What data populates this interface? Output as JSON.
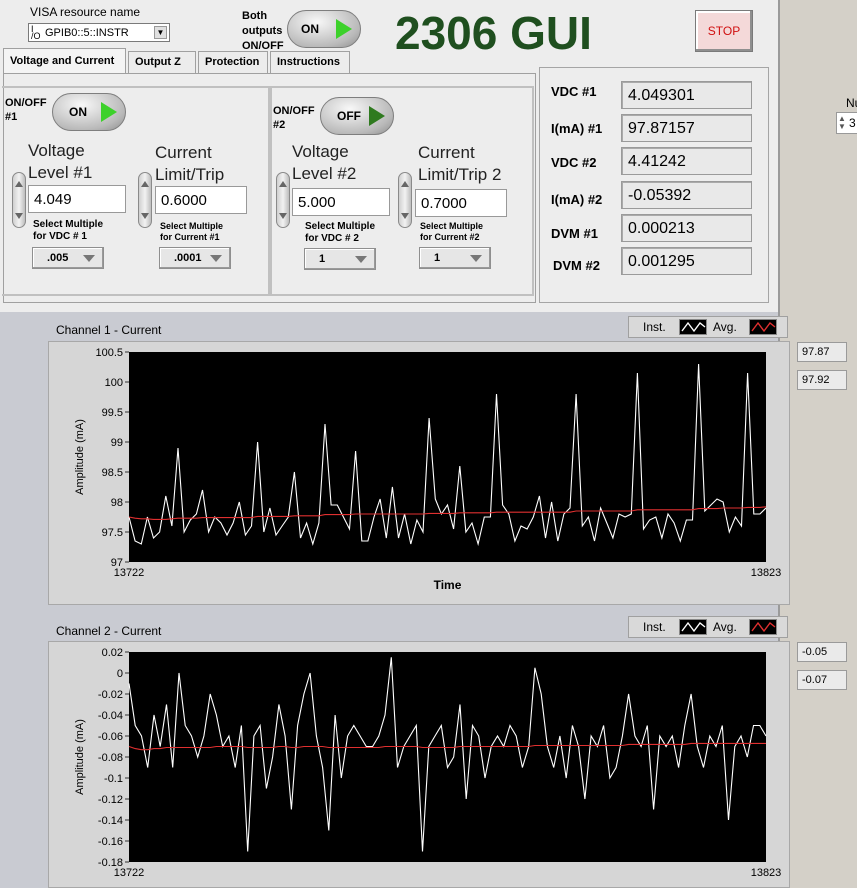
{
  "window": {
    "title": "2306 GUI"
  },
  "visa": {
    "label": "VISA resource name",
    "io_icon": "I/O",
    "value": "GPIB0::5::INSTR"
  },
  "both_outputs": {
    "label_line1": "Both",
    "label_line2": "outputs",
    "label_line3": "ON/OFF",
    "state": "ON"
  },
  "stop_button": {
    "label": "STOP"
  },
  "tabs": [
    {
      "label": "Voltage and Current"
    },
    {
      "label": "Output Z"
    },
    {
      "label": "Protection"
    },
    {
      "label": "Instructions"
    }
  ],
  "ch1": {
    "onoff_label_a": "ON/OFF",
    "onoff_label_b": "#1",
    "state": "ON",
    "voltage_label_a": "Voltage",
    "voltage_label_b": "Level #1",
    "voltage_value": "4.049",
    "current_label_a": "Current",
    "current_label_b": "Limit/Trip",
    "current_value": "0.6000",
    "mult_v_label_a": "Select Multiple",
    "mult_v_label_b": "for VDC # 1",
    "mult_v_value": ".005",
    "mult_i_label_a": "Select Multiple",
    "mult_i_label_b": "for Current #1",
    "mult_i_value": ".0001"
  },
  "ch2": {
    "onoff_label_a": "ON/OFF",
    "onoff_label_b": "#2",
    "state": "OFF",
    "voltage_label_a": "Voltage",
    "voltage_label_b": "Level #2",
    "voltage_value": "5.000",
    "current_label_a": "Current",
    "current_label_b": "Limit/Trip 2",
    "current_value": "0.7000",
    "mult_v_label_a": "Select Multiple",
    "mult_v_label_b": "for VDC # 2",
    "mult_v_value": "1",
    "mult_i_label_a": "Select Multiple",
    "mult_i_label_b": "for Current #2",
    "mult_i_value": "1"
  },
  "indicators": [
    {
      "label": "VDC #1",
      "value": "4.049301"
    },
    {
      "label": "I(mA) #1",
      "value": "97.87157"
    },
    {
      "label": "VDC #2",
      "value": "4.41242"
    },
    {
      "label": "I(mA) #2",
      "value": "-0.05392"
    },
    {
      "label": "DVM #1",
      "value": "0.000213"
    },
    {
      "label": "DVM #2",
      "value": "0.001295"
    }
  ],
  "right_partial": {
    "label": "Nu",
    "value": "3"
  },
  "legend": {
    "inst": "Inst.",
    "avg": "Avg."
  },
  "colors": {
    "inst": "#ffffff",
    "avg": "#e03030",
    "plot_bg": "#000000",
    "title": "#1f4f1f",
    "stop_text": "#d01010",
    "toggle_on": "#3cd12a"
  },
  "chart_data": [
    {
      "type": "line",
      "title": "Channel 1 - Current",
      "xlabel": "Time",
      "ylabel": "Amplitude (mA)",
      "xlim": [
        13722,
        13823
      ],
      "ylim": [
        97,
        100.5
      ],
      "y_ticks": [
        "100.5",
        "100",
        "99.5",
        "99",
        "98.5",
        "98",
        "97.5",
        "97"
      ],
      "x_ticks": [
        "13722",
        "13823"
      ],
      "series": [
        {
          "name": "Inst.",
          "values": [
            97.75,
            97.35,
            97.3,
            97.75,
            97.4,
            97.5,
            98.1,
            97.6,
            98.9,
            97.5,
            97.7,
            97.8,
            98.2,
            97.5,
            97.75,
            97.65,
            97.45,
            97.65,
            98.0,
            97.45,
            97.6,
            99.0,
            97.5,
            97.9,
            97.45,
            97.6,
            97.75,
            98.5,
            97.4,
            97.65,
            97.3,
            97.65,
            99.3,
            97.95,
            97.95,
            97.75,
            97.55,
            98.85,
            97.35,
            97.35,
            97.75,
            98.05,
            97.4,
            98.25,
            97.4,
            97.8,
            97.3,
            97.7,
            97.5,
            99.4,
            98.05,
            97.8,
            97.95,
            97.55,
            98.6,
            97.5,
            97.65,
            97.3,
            97.75,
            97.75,
            99.8,
            97.95,
            97.8,
            97.35,
            97.6,
            97.55,
            97.75,
            98.1,
            97.4,
            98.0,
            97.35,
            97.8,
            97.9,
            99.8,
            97.6,
            97.75,
            97.35,
            97.9,
            97.65,
            97.4,
            97.8,
            97.75,
            97.8,
            100.15,
            97.55,
            97.7,
            97.75,
            97.4,
            97.8,
            97.65,
            97.35,
            97.7,
            97.7,
            100.3,
            97.85,
            97.95,
            98.05,
            98.0,
            97.5,
            97.75,
            97.6,
            100.15,
            97.8,
            97.8,
            97.9
          ],
          "color": "#ffffff"
        },
        {
          "name": "Avg.",
          "values": [
            97.75,
            97.73,
            97.72,
            97.72,
            97.71,
            97.71,
            97.71,
            97.72,
            97.73,
            97.73,
            97.73,
            97.73,
            97.74,
            97.74,
            97.74,
            97.74,
            97.74,
            97.74,
            97.74,
            97.74,
            97.74,
            97.76,
            97.76,
            97.76,
            97.76,
            97.76,
            97.76,
            97.77,
            97.77,
            97.77,
            97.77,
            97.77,
            97.79,
            97.79,
            97.79,
            97.79,
            97.79,
            97.8,
            97.8,
            97.8,
            97.8,
            97.8,
            97.8,
            97.8,
            97.8,
            97.8,
            97.8,
            97.8,
            97.8,
            97.81,
            97.81,
            97.81,
            97.81,
            97.81,
            97.82,
            97.82,
            97.82,
            97.82,
            97.82,
            97.82,
            97.83,
            97.83,
            97.83,
            97.83,
            97.83,
            97.83,
            97.83,
            97.83,
            97.83,
            97.83,
            97.83,
            97.83,
            97.83,
            97.85,
            97.85,
            97.85,
            97.85,
            97.85,
            97.85,
            97.85,
            97.85,
            97.85,
            97.85,
            97.87,
            97.87,
            97.87,
            97.87,
            97.87,
            97.87,
            97.87,
            97.87,
            97.87,
            97.87,
            97.89,
            97.89,
            97.89,
            97.89,
            97.9,
            97.9,
            97.9,
            97.9,
            97.91,
            97.91,
            97.91,
            97.92
          ],
          "color": "#e03030"
        }
      ],
      "display_values": [
        "97.87",
        "97.92"
      ]
    },
    {
      "type": "line",
      "title": "Channel 2 - Current",
      "xlabel": "",
      "ylabel": "Amplitude (mA)",
      "xlim": [
        13722,
        13823
      ],
      "ylim": [
        -0.18,
        0.02
      ],
      "y_ticks": [
        "0.02",
        "0",
        "-0.02",
        "-0.04",
        "-0.06",
        "-0.08",
        "-0.1",
        "-0.12",
        "-0.14",
        "-0.16",
        "-0.18"
      ],
      "x_ticks": [
        "13722",
        "13823"
      ],
      "series": [
        {
          "name": "Inst.",
          "values": [
            -0.01,
            -0.05,
            -0.06,
            -0.09,
            -0.04,
            -0.07,
            -0.03,
            -0.09,
            0.0,
            -0.05,
            -0.06,
            -0.08,
            -0.06,
            -0.02,
            -0.04,
            -0.07,
            -0.06,
            -0.09,
            -0.05,
            -0.17,
            -0.06,
            -0.05,
            -0.11,
            -0.08,
            -0.03,
            -0.06,
            -0.13,
            -0.05,
            -0.02,
            0.0,
            -0.06,
            -0.09,
            -0.15,
            -0.04,
            -0.1,
            -0.06,
            -0.05,
            -0.06,
            -0.07,
            -0.07,
            -0.06,
            -0.04,
            0.015,
            -0.09,
            -0.07,
            -0.06,
            -0.05,
            -0.17,
            -0.07,
            -0.06,
            -0.05,
            -0.09,
            -0.08,
            -0.03,
            -0.12,
            -0.05,
            -0.06,
            -0.1,
            -0.07,
            -0.06,
            -0.07,
            -0.05,
            -0.06,
            -0.09,
            -0.07,
            0.005,
            -0.02,
            -0.07,
            -0.09,
            -0.06,
            -0.1,
            -0.05,
            -0.07,
            -0.12,
            -0.06,
            -0.07,
            -0.05,
            -0.1,
            -0.09,
            -0.06,
            -0.02,
            -0.06,
            -0.07,
            -0.05,
            -0.13,
            -0.06,
            -0.07,
            -0.06,
            -0.09,
            -0.05,
            -0.02,
            -0.07,
            -0.09,
            -0.06,
            -0.07,
            -0.05,
            -0.14,
            -0.07,
            -0.06,
            -0.08,
            -0.05,
            -0.05,
            -0.06
          ],
          "color": "#ffffff"
        },
        {
          "name": "Avg.",
          "values": [
            -0.07,
            -0.072,
            -0.073,
            -0.073,
            -0.072,
            -0.072,
            -0.071,
            -0.071,
            -0.071,
            -0.071,
            -0.071,
            -0.071,
            -0.071,
            -0.071,
            -0.07,
            -0.07,
            -0.07,
            -0.07,
            -0.07,
            -0.071,
            -0.071,
            -0.071,
            -0.071,
            -0.071,
            -0.07,
            -0.07,
            -0.071,
            -0.071,
            -0.07,
            -0.07,
            -0.07,
            -0.07,
            -0.071,
            -0.071,
            -0.071,
            -0.071,
            -0.071,
            -0.071,
            -0.071,
            -0.071,
            -0.071,
            -0.07,
            -0.07,
            -0.07,
            -0.07,
            -0.07,
            -0.07,
            -0.071,
            -0.071,
            -0.071,
            -0.071,
            -0.071,
            -0.071,
            -0.07,
            -0.07,
            -0.07,
            -0.07,
            -0.07,
            -0.07,
            -0.07,
            -0.07,
            -0.07,
            -0.07,
            -0.07,
            -0.07,
            -0.069,
            -0.069,
            -0.069,
            -0.069,
            -0.069,
            -0.069,
            -0.069,
            -0.069,
            -0.069,
            -0.069,
            -0.069,
            -0.069,
            -0.069,
            -0.069,
            -0.069,
            -0.068,
            -0.068,
            -0.068,
            -0.068,
            -0.068,
            -0.068,
            -0.068,
            -0.068,
            -0.068,
            -0.068,
            -0.067,
            -0.067,
            -0.067,
            -0.067,
            -0.067,
            -0.067,
            -0.067,
            -0.067,
            -0.067,
            -0.067,
            -0.067,
            -0.067,
            -0.067
          ],
          "color": "#e03030"
        }
      ],
      "display_values": [
        "-0.05",
        "-0.07"
      ]
    }
  ]
}
